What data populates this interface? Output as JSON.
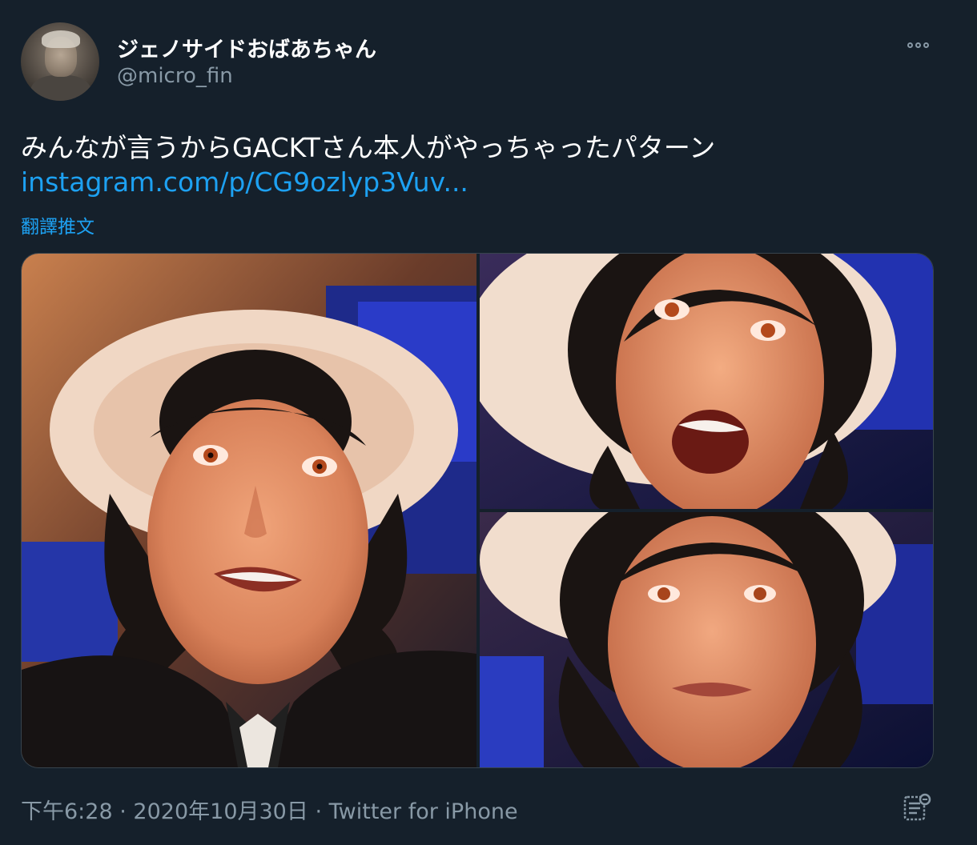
{
  "user": {
    "display_name": "ジェノサイドおばあちゃん",
    "handle": "@micro_fin"
  },
  "tweet": {
    "text": "みんなが言うからGACKTさん本人がやっちゃったパターン",
    "link_text": "instagram.com/p/CG9ozlyp3Vuv...",
    "translate_label": "翻譯推文"
  },
  "footer": {
    "time": "下午6:28",
    "separator": "·",
    "date": "2020年10月30日",
    "source": "Twitter for iPhone"
  },
  "colors": {
    "background": "#15202b",
    "link": "#1da1f2",
    "secondary_text": "#8899a6",
    "border": "#38444d"
  },
  "icons": {
    "more": "more-horizontal-icon",
    "analytics": "analytics-icon"
  }
}
